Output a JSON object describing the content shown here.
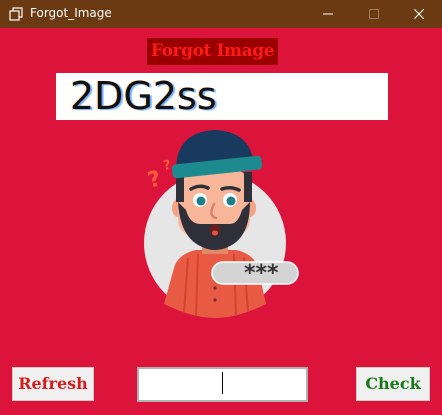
{
  "window": {
    "title": "Forgot_Image",
    "icon": "window-restore-icon",
    "controls": [
      "minimize-icon",
      "maximize-icon",
      "close-icon"
    ]
  },
  "heading": "Forgot Image",
  "captcha": {
    "text": "2DG2ss"
  },
  "illustration": {
    "password_mask": "***",
    "icon": "person-forgot-password-icon"
  },
  "buttons": {
    "refresh_label": "Refresh",
    "check_label": "Check"
  },
  "input": {
    "value": ""
  },
  "colors": {
    "background": "#dc143c",
    "titlebar": "#6b3a12",
    "heading_bg": "#9b0000",
    "heading_text": "#ff1a1a",
    "refresh_text": "#d41c1c",
    "check_text": "#1a7a1a"
  }
}
